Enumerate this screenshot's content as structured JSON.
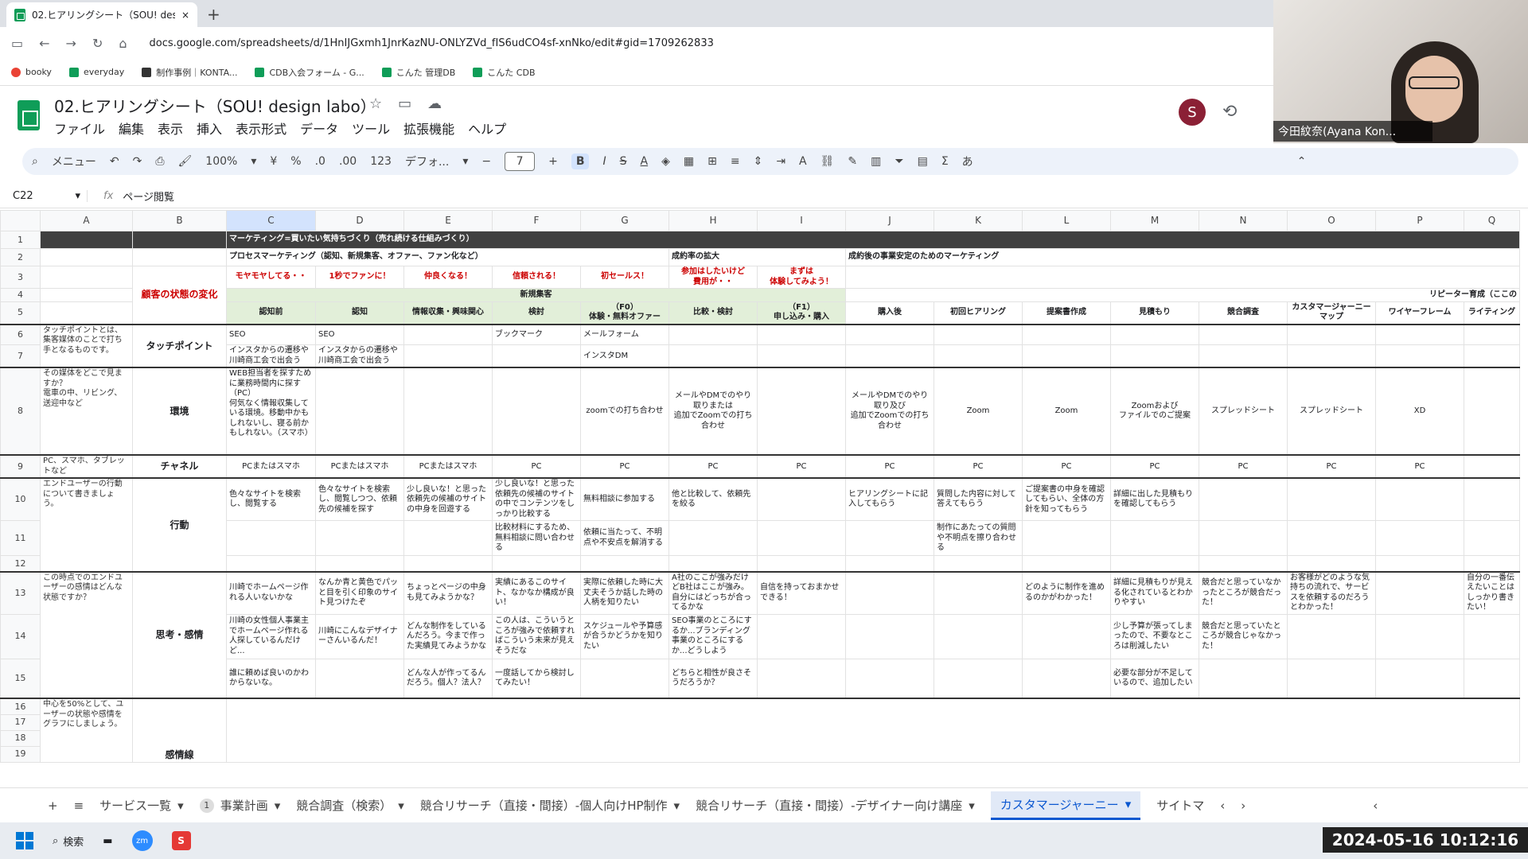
{
  "browser": {
    "tab_title": "02.ヒアリングシート（SOU! design l",
    "tab_close": "×",
    "new_tab": "+",
    "url": "docs.google.com/spreadsheets/d/1HnIJGxmh1JnrKazNU-ONLYZVd_fIS6udCO4sf-xnNko/edit#gid=1709262833",
    "bookmarks": [
      "booky",
      "everyday",
      "制作事例｜KONTA...",
      "CDB入会フォーム - G...",
      "こんた 管理DB",
      "こんた CDB"
    ]
  },
  "doc": {
    "title": "02.ヒアリングシート（SOU! design labo）",
    "menu": [
      "ファイル",
      "編集",
      "表示",
      "挿入",
      "表示形式",
      "データ",
      "ツール",
      "拡張機能",
      "ヘルプ"
    ],
    "avatar_letter": "S"
  },
  "toolbar": {
    "search": "メニュー",
    "zoom": "100%",
    "currency": "¥",
    "percent": "%",
    "dec_less": ".0",
    "dec_more": ".00",
    "num_format": "123",
    "font": "デフォ...",
    "font_size": "7",
    "minus": "−",
    "plus": "+",
    "bold": "B",
    "italic": "I",
    "strike": "S",
    "text_color": "A",
    "input_tools": "あ"
  },
  "formula": {
    "cell_ref": "C22",
    "fx": "fx",
    "content": "ページ閲覧"
  },
  "columns": [
    "",
    "A",
    "B",
    "C",
    "D",
    "E",
    "F",
    "G",
    "H",
    "I",
    "J",
    "K",
    "L",
    "M",
    "N",
    "O",
    "P",
    "Q"
  ],
  "sheet": {
    "r1_title": "マーケティング=買いたい気持ちづくり（売れ続ける仕組みづくり）",
    "r2_process": "プロセスマーケティング（認知、新規集客、オファー、ファン化など）",
    "r2_expand": "成約率の拡大",
    "r2_after": "成約後の事業安定のためのマーケティング",
    "r3_label": "顧客の状態の変化",
    "r3_states": [
      "モヤモヤしてる・・",
      "1秒でファンに！",
      "仲良くなる！",
      "信頼される！",
      "初セールス！",
      "参加はしたいけど\n費用が・・",
      "まずは\n体験してみよう！"
    ],
    "r4_new": "新規集客",
    "r4_repeat": "リピーター育成（ここの",
    "r5_stages": [
      "認知前",
      "認知",
      "情報収集・興味関心",
      "検討",
      "（F0）\n体験・無料オファー",
      "比較・検討",
      "（F1）\n申し込み・購入",
      "購入後",
      "初回ヒアリング",
      "提案書作成",
      "見積もり",
      "競合調査",
      "カスタマージャーニー\nマップ",
      "ワイヤーフレーム",
      "ライティング"
    ],
    "touch_note": "タッチポイントとは、集客媒体のことで打ち手となるものです。",
    "touch_label": "タッチポイント",
    "r6": [
      "SEO",
      "SEO",
      "",
      "ブックマーク",
      "メールフォーム"
    ],
    "r7": [
      "インスタからの遷移や川崎商工会で出会う",
      "インスタからの遷移や川崎商工会で出会う",
      "",
      "",
      "インスタDM"
    ],
    "env_note": "その媒体をどこで見ますか？\n電車の中、リビング、送迎中など",
    "env_label": "環境",
    "r8": [
      "WEB担当者を探すために業務時間内に探す（PC）\n何気なく情報収集している環境。移動中かもしれないし、寝る前かもしれない。（スマホ）",
      "",
      "",
      "",
      "zoomでの打ち合わせ",
      "メールやDMでのやり取りまたは\n追加でZoomでの打ち合わせ",
      "",
      "メールやDMでのやり取り及び\n追加でZoomでの打ち合わせ",
      "Zoom",
      "Zoom",
      "Zoomおよび\nファイルでのご提案",
      "スプレッドシート",
      "スプレッドシート",
      "XD"
    ],
    "ch_note": "PC、スマホ、タブレットなど",
    "ch_label": "チャネル",
    "r9": [
      "PCまたはスマホ",
      "PCまたはスマホ",
      "PCまたはスマホ",
      "PC",
      "PC",
      "PC",
      "PC",
      "PC",
      "PC",
      "PC",
      "PC",
      "PC",
      "PC",
      "PC"
    ],
    "act_note": "エンドユーザーの行動について書きましょう。",
    "act_label": "行動",
    "r10": [
      "色々なサイトを検索し、閲覧する",
      "色々なサイトを検索し、閲覧しつつ、依頼先の候補を探す",
      "少し良いな！と思った依頼先の候補のサイトの中身を回遊する",
      "少し良いな！と思った依頼先の候補のサイトの中でコンテンツをしっかり比較する",
      "無料相談に参加する",
      "他と比較して、依頼先を絞る",
      "",
      "ヒアリングシートに記入してもらう",
      "質問した内容に対して答えてもらう",
      "ご提案書の中身を確認してもらい、全体の方針を知ってもらう",
      "詳細に出した見積もりを確認してもらう"
    ],
    "r11": [
      "",
      "",
      "",
      "比較材料にするため、無料相談に問い合わせる",
      "依頼に当たって、不明点や不安点を解消する",
      "",
      "",
      "",
      "制作にあたっての質問や不明点を擦り合わせる"
    ],
    "think_note": "この時点でのエンドユーザーの感情はどんな状態ですか？",
    "think_label": "思考・感情",
    "r13": [
      "川崎でホームページ作れる人いないかな",
      "なんか青と黄色でパッと目を引く印象のサイト見つけたぞ",
      "ちょっとページの中身も見てみようかな？",
      "実績にあるこのサイト、なかなか構成が良い！",
      "実際に依頼した時に大丈夫そうか話した時の人柄を知りたい",
      "A社のここが強みだけどB社はここが強み。自分にはどっちが合ってるかな",
      "自信を持っておまかせできる！",
      "",
      "",
      "どのように制作を進めるのかがわかった！",
      "詳細に見積もりが見える化されているとわかりやすい",
      "競合だと思っていなかったところが競合だった！",
      "お客様がどのような気持ちの流れで、サービスを依頼するのだろうとわかった！",
      "",
      "自分の一番伝えたいことはしっかり書きたい！"
    ],
    "r14": [
      "川崎の女性個人事業主でホームページ作れる人探しているんだけど...",
      "川崎にこんなデザイナーさんいるんだ！",
      "どんな制作をしているんだろう。今まで作った実績見てみようかな",
      "この人は、こういうところが強みで依頼すればこういう未来が見えそうだな",
      "スケジュールや予算感が合うかどうかを知りたい",
      "SEO事業のところにするか...ブランディング事業のところにするか...どうしよう",
      "",
      "",
      "",
      "",
      "少し予算が張ってしまったので、不要なところは削減したい",
      "競合だと思っていたところが競合じゃなかった！"
    ],
    "r15": [
      "誰に頼めば良いのかわからないな。",
      "",
      "どんな人が作ってるんだろう。個人？法人？",
      "一度話してから検討してみたい！",
      "",
      "どちらと相性が良さそうだろうか？",
      "",
      "",
      "",
      "",
      "必要な部分が不足しているので、追加したい"
    ],
    "graph_note": "中心を50%として、ユーザーの状態や感情をグラフにしましょう。",
    "graph_label": "感情線",
    "rows": [
      "1",
      "2",
      "3",
      "4",
      "5",
      "6",
      "7",
      "8",
      "9",
      "10",
      "11",
      "12",
      "13",
      "14",
      "15",
      "16",
      "17",
      "18",
      "19"
    ]
  },
  "sheet_tabs": {
    "add": "+",
    "list": "≡",
    "tabs": [
      "サービス一覧",
      "事業計画",
      "競合調査（検索）",
      "競合リサーチ（直接・間接）-個人向けHP制作",
      "競合リサーチ（直接・間接）-デザイナー向け講座",
      "カスタマージャーニー",
      "サイトマ"
    ],
    "badge": "1",
    "active_index": 5
  },
  "taskbar": {
    "search": "検索",
    "clock": "2024-05-16  10:12:16"
  },
  "video": {
    "name": "今田紋奈(Ayana Kon..."
  }
}
